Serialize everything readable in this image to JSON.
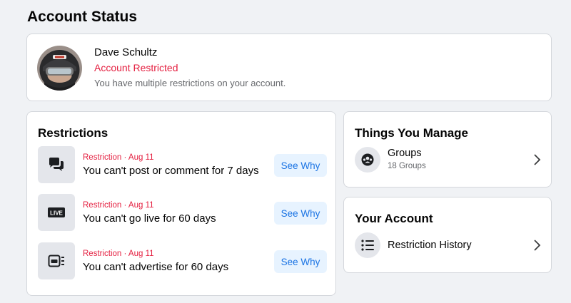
{
  "page": {
    "title": "Account Status"
  },
  "profile": {
    "name": "Dave Schultz",
    "status": "Account Restricted",
    "description": "You have multiple restrictions on your account.",
    "status_color": "#e41e3f"
  },
  "restrictions": {
    "title": "Restrictions",
    "items": [
      {
        "icon": "chat-bubbles-icon",
        "meta": "Restriction · Aug 11",
        "title": "You can't post or comment for 7 days",
        "button": "See Why"
      },
      {
        "icon": "live-icon",
        "live_badge": "LIVE",
        "meta": "Restriction · Aug 11",
        "title": "You can't go live for 60 days",
        "button": "See Why"
      },
      {
        "icon": "ad-icon",
        "meta": "Restriction · Aug 11",
        "title": "You can't advertise for 60 days",
        "button": "See Why"
      }
    ]
  },
  "things_you_manage": {
    "title": "Things You Manage",
    "items": [
      {
        "icon": "groups-icon",
        "label": "Groups",
        "sublabel": "18 Groups"
      }
    ]
  },
  "your_account": {
    "title": "Your Account",
    "items": [
      {
        "icon": "list-icon",
        "label": "Restriction History"
      }
    ]
  },
  "colors": {
    "accent": "#1b74e4",
    "button_bg": "#e7f3ff",
    "restriction_red": "#e41e3f",
    "background": "#f0f2f5"
  }
}
